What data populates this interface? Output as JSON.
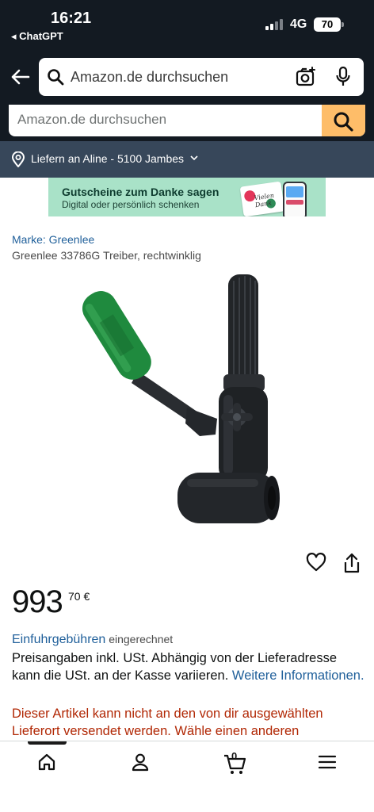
{
  "status": {
    "time": "16:21",
    "back_app": "◂ ChatGPT",
    "network": "4G",
    "battery": "70"
  },
  "header": {
    "search_placeholder": "Amazon.de durchsuchen"
  },
  "web_search": {
    "placeholder": "Amazon.de durchsuchen"
  },
  "delivery": {
    "text": "Liefern an Aline - 5100 Jambes"
  },
  "banner": {
    "headline": "Gutscheine zum Danke sagen",
    "subline": "Digital oder persönlich schenken",
    "card_script": "Vielen Dank",
    "colors": {
      "background": "#a9e2c8"
    }
  },
  "product": {
    "brand_link": "Marke: Greenlee",
    "title": "Greenlee 33786G Treiber, rechtwinklig",
    "image_icon": "hydraulic-driver-tool-image"
  },
  "price": {
    "whole": "993",
    "fraction": "70 €"
  },
  "import_fees": {
    "link": "Einfuhrgebühren",
    "suffix": " eingerechnet"
  },
  "tax_note": {
    "text": "Preisangaben inkl. USt. Abhängig von der Lieferadresse kann die USt. an der Kasse variieren.",
    "link": "Weitere Informationen."
  },
  "warning": "Dieser Artikel kann nicht an den von dir ausgewählten Lieferort versendet werden. Wähle einen anderen",
  "bottom_nav": {
    "cart_count": "0"
  },
  "colors": {
    "header_bg": "#131a22",
    "delivery_bg": "#37475a",
    "search_button": "#febd69",
    "link": "#1f5f9a",
    "warning": "#b12704",
    "handle_green": "#1f8a3e"
  }
}
